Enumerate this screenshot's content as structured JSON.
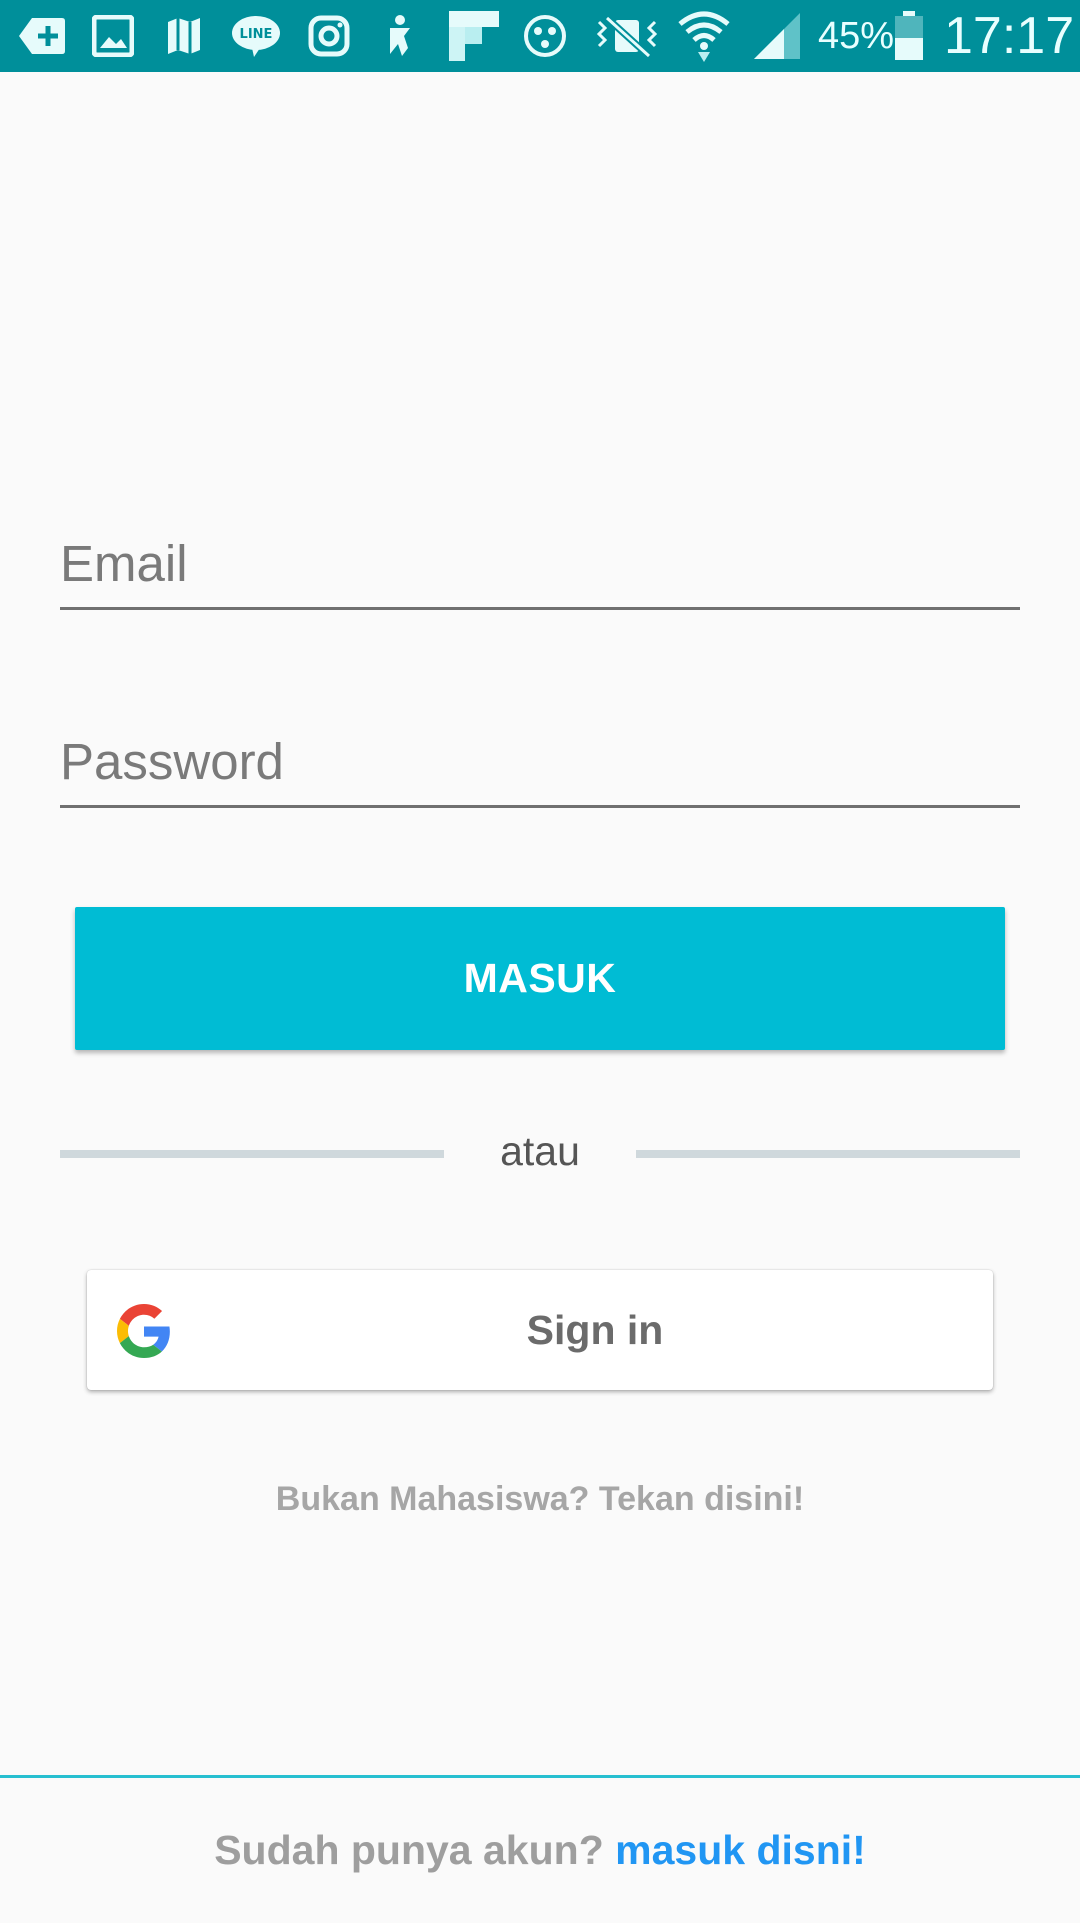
{
  "status_bar": {
    "battery_percent": "45%",
    "time": "17:17",
    "background_color": "#008f9a",
    "icons": [
      "add-notification-icon",
      "gallery-icon",
      "maps-icon",
      "line-icon",
      "instagram-icon",
      "accessibility-icon",
      "flipboard-icon",
      "app-icon",
      "mute-vibrate-icon",
      "wifi-icon",
      "signal-icon",
      "battery-icon"
    ]
  },
  "form": {
    "email_placeholder": "Email",
    "email_value": "",
    "password_placeholder": "Password",
    "password_value": ""
  },
  "login_button": {
    "label": "MASUK",
    "color": "#00bcd4"
  },
  "divider": {
    "label": "atau"
  },
  "google_button": {
    "label": "Sign in"
  },
  "non_student_link": "Bukan Mahasiswa? Tekan disini!",
  "footer": {
    "prompt": "Sudah punya akun?",
    "link": "masuk disni!",
    "link_color": "#2196f3"
  }
}
